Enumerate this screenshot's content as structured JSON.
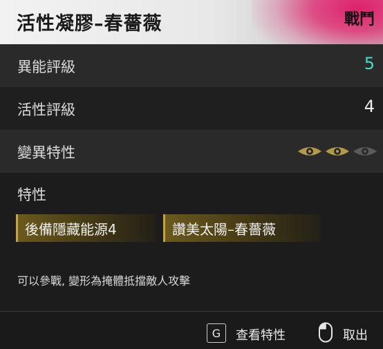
{
  "header": {
    "title": "活性凝膠–春薔薇",
    "category": "戰鬥",
    "accent": "#e0206a"
  },
  "stats": [
    {
      "label": "異能評級",
      "value": "5",
      "color": "#3fe0c6"
    },
    {
      "label": "活性評級",
      "value": "4",
      "color": "#ededed"
    },
    {
      "label": "變異特性",
      "eyes_lit": 2,
      "eyes_total": 3
    }
  ],
  "traits": {
    "label": "特性",
    "tags": [
      "後備隱藏能源4",
      "讚美太陽–春薔薇"
    ]
  },
  "description": "可以參戰, 變形為掩體抵擋敵人攻擊",
  "footer": {
    "view_key": "G",
    "view_label": "查看特性",
    "cancel_icon": "mouse-icon",
    "cancel_label": "取出"
  }
}
